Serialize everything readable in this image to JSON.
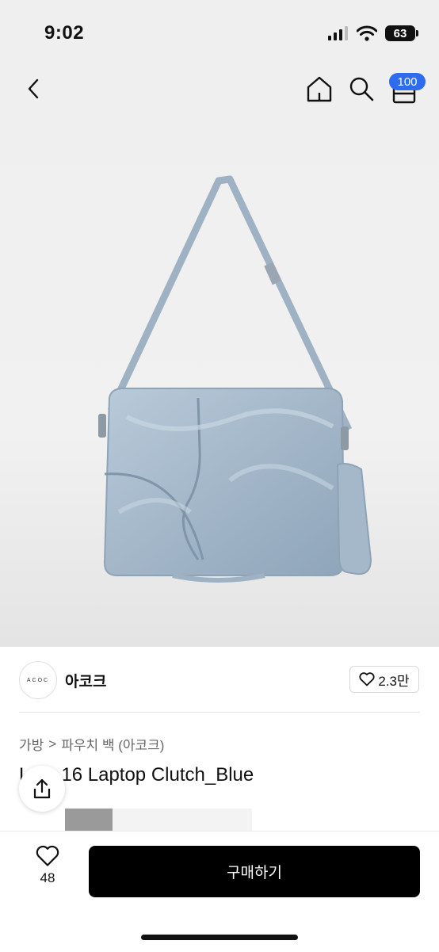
{
  "status_bar": {
    "time": "9:02",
    "battery": "63"
  },
  "nav": {
    "cart_badge": "100"
  },
  "shop": {
    "logo_text": "ACOC",
    "name": "아코크",
    "like_count": "2.3만"
  },
  "breadcrumb": {
    "category": "가방",
    "separator": ">",
    "subcategory": "파우치 백 (아코크)"
  },
  "product": {
    "title": "Lo...o 16 Laptop Clutch_Blue",
    "visible_title": "Lo   o 16 Laptop Clutch_Blue"
  },
  "bottom_bar": {
    "wish_count": "48",
    "buy_label": "구매하기"
  },
  "colors": {
    "accent_badge": "#2f6bef",
    "buy_button": "#000000",
    "bag_blue": "#a9bccd"
  }
}
